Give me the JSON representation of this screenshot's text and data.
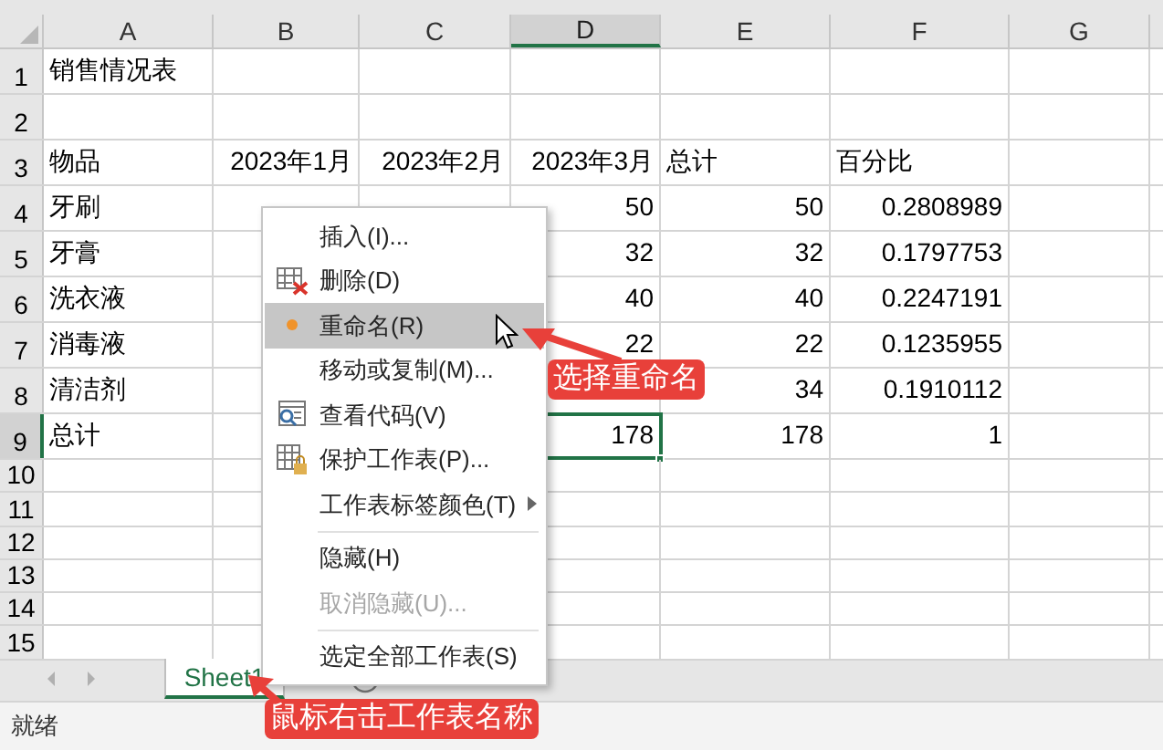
{
  "columns": [
    {
      "label": "A",
      "selected": false
    },
    {
      "label": "B",
      "selected": false
    },
    {
      "label": "C",
      "selected": false
    },
    {
      "label": "D",
      "selected": true
    },
    {
      "label": "E",
      "selected": false
    },
    {
      "label": "F",
      "selected": false
    },
    {
      "label": "G",
      "selected": false
    }
  ],
  "rows": [
    {
      "label": "1",
      "selected": false,
      "cells": [
        {
          "text": "销售情况表",
          "kind": "text",
          "selected": false
        },
        null,
        null,
        null,
        null,
        null,
        null
      ]
    },
    {
      "label": "2",
      "selected": false,
      "cells": []
    },
    {
      "label": "3",
      "selected": false,
      "cells": [
        {
          "text": "物品",
          "kind": "text",
          "selected": false
        },
        {
          "text": "2023年1月",
          "kind": "number",
          "selected": false
        },
        {
          "text": "2023年2月",
          "kind": "number",
          "selected": false
        },
        {
          "text": "2023年3月",
          "kind": "number",
          "selected": false
        },
        {
          "text": "总计",
          "kind": "text",
          "selected": false
        },
        {
          "text": "百分比",
          "kind": "text",
          "selected": false
        },
        null
      ]
    },
    {
      "label": "4",
      "selected": false,
      "cells": [
        {
          "text": "牙刷",
          "kind": "text",
          "selected": false
        },
        null,
        null,
        {
          "text": "50",
          "kind": "number",
          "selected": false
        },
        {
          "text": "50",
          "kind": "number",
          "selected": false
        },
        {
          "text": "0.2808989",
          "kind": "number",
          "selected": false
        },
        null
      ]
    },
    {
      "label": "5",
      "selected": false,
      "cells": [
        {
          "text": "牙膏",
          "kind": "text",
          "selected": false
        },
        null,
        null,
        {
          "text": "32",
          "kind": "number",
          "selected": false
        },
        {
          "text": "32",
          "kind": "number",
          "selected": false
        },
        {
          "text": "0.1797753",
          "kind": "number",
          "selected": false
        },
        null
      ]
    },
    {
      "label": "6",
      "selected": false,
      "cells": [
        {
          "text": "洗衣液",
          "kind": "text",
          "selected": false
        },
        null,
        null,
        {
          "text": "40",
          "kind": "number",
          "selected": false
        },
        {
          "text": "40",
          "kind": "number",
          "selected": false
        },
        {
          "text": "0.2247191",
          "kind": "number",
          "selected": false
        },
        null
      ]
    },
    {
      "label": "7",
      "selected": false,
      "cells": [
        {
          "text": "消毒液",
          "kind": "text",
          "selected": false
        },
        null,
        null,
        {
          "text": "22",
          "kind": "number",
          "selected": false
        },
        {
          "text": "22",
          "kind": "number",
          "selected": false
        },
        {
          "text": "0.1235955",
          "kind": "number",
          "selected": false
        },
        null
      ]
    },
    {
      "label": "8",
      "selected": false,
      "cells": [
        {
          "text": "清洁剂",
          "kind": "text",
          "selected": false
        },
        null,
        null,
        null,
        {
          "text": "34",
          "kind": "number",
          "selected": false
        },
        {
          "text": "0.1910112",
          "kind": "number",
          "selected": false
        },
        null
      ]
    },
    {
      "label": "9",
      "selected": true,
      "cells": [
        {
          "text": "总计",
          "kind": "text",
          "selected": false
        },
        null,
        null,
        {
          "text": "178",
          "kind": "number",
          "selected": true
        },
        {
          "text": "178",
          "kind": "number",
          "selected": false
        },
        {
          "text": "1",
          "kind": "number",
          "selected": false
        },
        null
      ]
    },
    {
      "label": "10",
      "selected": false,
      "cells": []
    },
    {
      "label": "11",
      "selected": false,
      "cells": []
    },
    {
      "label": "12",
      "selected": false,
      "cells": []
    },
    {
      "label": "13",
      "selected": false,
      "cells": []
    },
    {
      "label": "14",
      "selected": false,
      "cells": []
    },
    {
      "label": "15",
      "selected": false,
      "cells": []
    }
  ],
  "context_menu": [
    {
      "kind": "item",
      "label": "插入(I)...",
      "selected": false,
      "disabled": false
    },
    {
      "kind": "item",
      "label": "删除(D)",
      "selected": false,
      "disabled": false
    },
    {
      "kind": "item",
      "label": "重命名(R)",
      "selected": true,
      "disabled": false
    },
    {
      "kind": "item",
      "label": "移动或复制(M)...",
      "selected": false,
      "disabled": false
    },
    {
      "kind": "item",
      "label": "查看代码(V)",
      "selected": false,
      "disabled": false
    },
    {
      "kind": "item",
      "label": "保护工作表(P)...",
      "selected": false,
      "disabled": false
    },
    {
      "kind": "submenu",
      "label": "工作表标签颜色(T)",
      "selected": false,
      "disabled": false
    },
    {
      "kind": "separator"
    },
    {
      "kind": "item",
      "label": "隐藏(H)",
      "selected": false,
      "disabled": false
    },
    {
      "kind": "item",
      "label": "取消隐藏(U)...",
      "selected": false,
      "disabled": true
    },
    {
      "kind": "separator"
    },
    {
      "kind": "item",
      "label": "选定全部工作表(S)",
      "selected": false,
      "disabled": false
    }
  ],
  "sheet_tabs": [
    {
      "label": "Sheet1",
      "selected": true
    }
  ],
  "status_bar": {
    "text": "就绪"
  },
  "annotations": [
    {
      "text": "选择重命名"
    },
    {
      "text": "鼠标右击工作表名称"
    }
  ]
}
